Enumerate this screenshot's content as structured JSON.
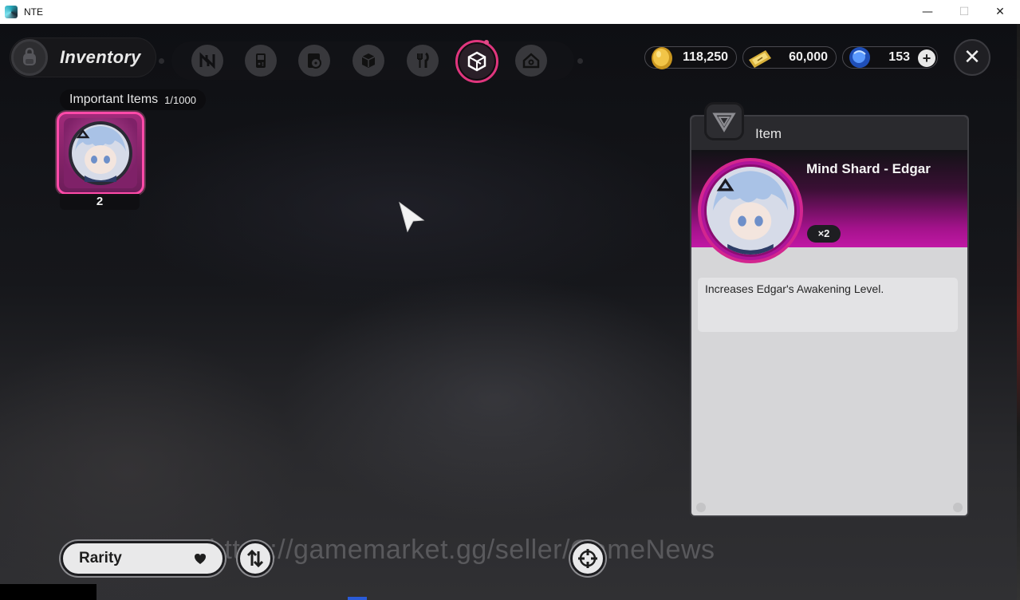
{
  "window": {
    "title": "NTE",
    "minimize_glyph": "—",
    "maximize_glyph": "☐",
    "close_glyph": "✕"
  },
  "header": {
    "title": "Inventory",
    "tabs": [
      {
        "id": "n-logo",
        "icon": "n-logo-icon",
        "active": false
      },
      {
        "id": "gadget",
        "icon": "handheld-device-icon",
        "active": false
      },
      {
        "id": "disc",
        "icon": "disc-icon",
        "active": false
      },
      {
        "id": "box",
        "icon": "box-icon",
        "active": false
      },
      {
        "id": "food",
        "icon": "fork-knife-icon",
        "active": false
      },
      {
        "id": "important",
        "icon": "cube-emblem-icon",
        "active": true
      },
      {
        "id": "home",
        "icon": "house-icon",
        "active": false
      }
    ],
    "currencies": [
      {
        "id": "gold",
        "icon": "gold-coin-icon",
        "value": "118,250"
      },
      {
        "id": "ticket",
        "icon": "ticket-icon",
        "value": "60,000"
      },
      {
        "id": "crystal",
        "icon": "blue-crystal-icon",
        "value": "153"
      }
    ],
    "plus_glyph": "+",
    "close_glyph": "✕"
  },
  "section": {
    "name": "Important Items",
    "count": "1/1000"
  },
  "items": [
    {
      "name": "Mind Shard - Edgar",
      "quantity": "2",
      "rarity_color": "#c0379a"
    }
  ],
  "detail": {
    "header": "Item",
    "name": "Mind Shard - Edgar",
    "quantity": "×2",
    "description": "Increases Edgar's Awakening Level."
  },
  "bottom": {
    "sort_value": "Rarity"
  },
  "watermark": "https://gamemarket.gg/seller/GameNews",
  "colors": {
    "accent": "#e0367e",
    "rarity_purple": "#c118a5"
  }
}
